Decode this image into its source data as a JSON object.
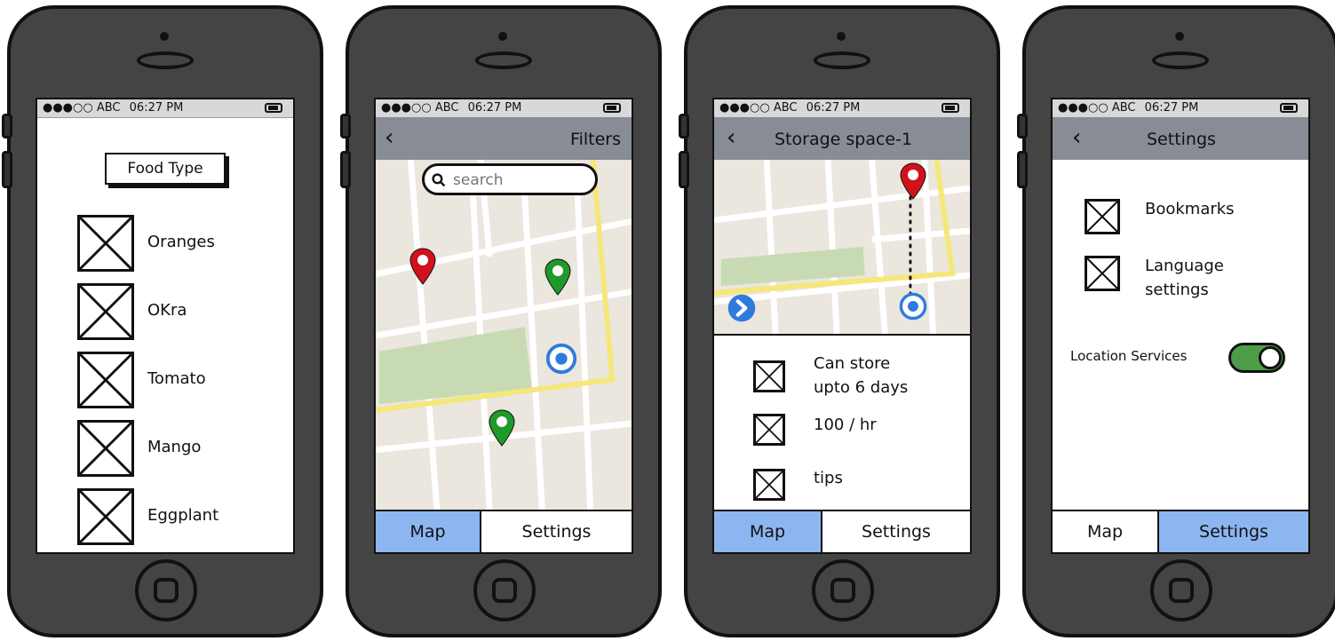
{
  "status": {
    "carrier": "●●●○○ ABC",
    "time": "06:27 PM"
  },
  "screen1": {
    "heading": "Food Type",
    "items": [
      "Oranges",
      "OKra",
      "Tomato",
      "Mango",
      "Eggplant"
    ]
  },
  "screen2": {
    "nav_title": "Filters",
    "search_placeholder": "search"
  },
  "screen3": {
    "nav_title": "Storage space-1",
    "details": [
      "Can store\nupto 6 days",
      "100 / hr",
      "tips"
    ]
  },
  "screen4": {
    "nav_title": "Settings",
    "options": [
      "Bookmarks",
      "Language\nsettings"
    ],
    "location_label": "Location Services",
    "location_enabled": true
  },
  "tabs": {
    "map": "Map",
    "settings": "Settings"
  },
  "colors": {
    "navbar": "#888c94",
    "tab_active": "#8db5ef",
    "pin_red": "#d2121b",
    "pin_green": "#1f9a2a",
    "location_blue": "#2f7bdc",
    "toggle_on": "#4d9c48",
    "map_road_edge": "#f5e77a",
    "park": "#c7dab4"
  },
  "icons": [
    "back-chevron-icon",
    "search-icon",
    "map-pin-icon",
    "current-location-icon",
    "next-arrow-icon",
    "battery-icon",
    "home-button-icon"
  ]
}
